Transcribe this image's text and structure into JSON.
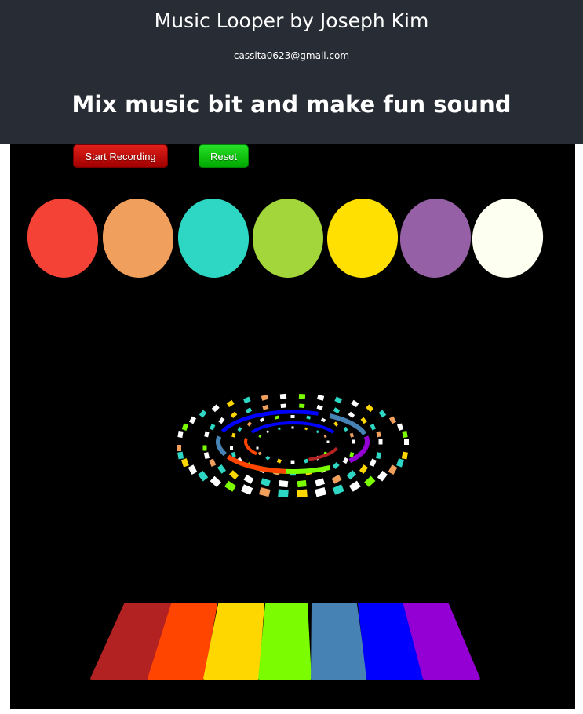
{
  "header": {
    "title": "Music Looper by Joseph Kim",
    "email": "cassita0623@gmail.com",
    "tagline": "Mix music bit and make fun sound"
  },
  "controls": {
    "record_label": "Start Recording",
    "reset_label": "Reset"
  },
  "sound_pads": [
    {
      "name": "red",
      "color": "#f44336"
    },
    {
      "name": "orange",
      "color": "#f0a05c"
    },
    {
      "name": "teal",
      "color": "#2ed6c4"
    },
    {
      "name": "lime",
      "color": "#a3d63a"
    },
    {
      "name": "yellow",
      "color": "#ffe000"
    },
    {
      "name": "purple",
      "color": "#9560a6"
    },
    {
      "name": "ivory",
      "color": "#fdfff0"
    }
  ],
  "keys": [
    {
      "name": "firebrick",
      "color": "#b22222"
    },
    {
      "name": "orange-red",
      "color": "#ff4500"
    },
    {
      "name": "gold",
      "color": "#ffd700"
    },
    {
      "name": "lawn-green",
      "color": "#7cfc00"
    },
    {
      "name": "steel-blue",
      "color": "#4682b4"
    },
    {
      "name": "blue",
      "color": "#0000ff"
    },
    {
      "name": "dark-violet",
      "color": "#9400d3"
    }
  ]
}
